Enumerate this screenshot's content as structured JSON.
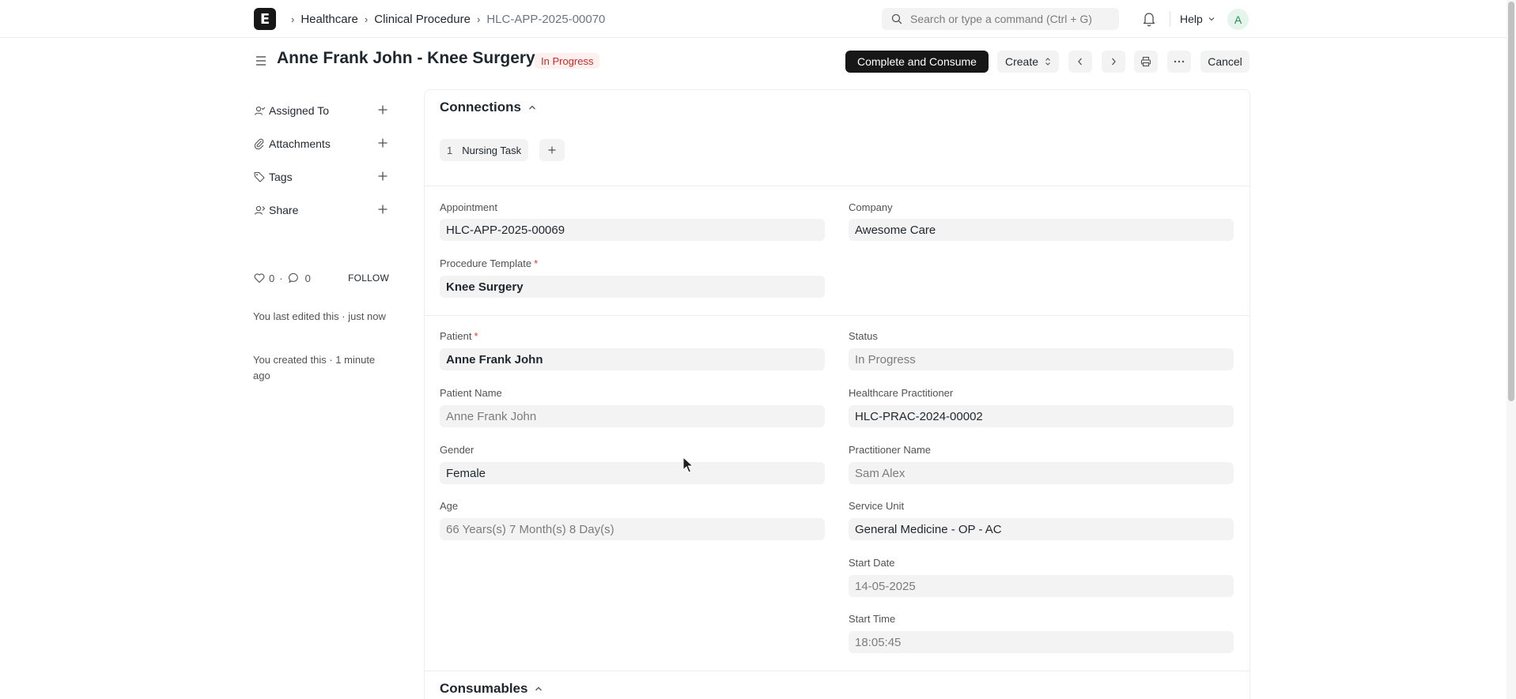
{
  "navbar": {
    "logo_letter": "E",
    "breadcrumbs": [
      {
        "label": "Healthcare"
      },
      {
        "label": "Clinical Procedure"
      },
      {
        "label": "HLC-APP-2025-00070"
      }
    ],
    "search_placeholder": "Search or type a command (Ctrl + G)",
    "help_label": "Help",
    "avatar_initial": "A"
  },
  "page": {
    "title": "Anne Frank John - Knee Surgery",
    "status": "In Progress",
    "buttons": {
      "complete": "Complete and Consume",
      "create": "Create",
      "cancel": "Cancel"
    }
  },
  "sidebar": {
    "items": [
      {
        "label": "Assigned To",
        "icon": "assign-icon"
      },
      {
        "label": "Attachments",
        "icon": "paperclip-icon"
      },
      {
        "label": "Tags",
        "icon": "tag-icon"
      },
      {
        "label": "Share",
        "icon": "share-icon"
      }
    ],
    "likes": "0",
    "comments": "0",
    "follow_label": "FOLLOW",
    "activity": [
      "You last edited this · just now",
      "You created this · 1 minute ago"
    ]
  },
  "connections": {
    "title": "Connections",
    "chip_count": "1",
    "chip_label": "Nursing Task"
  },
  "fields": {
    "appointment": {
      "label": "Appointment",
      "value": "HLC-APP-2025-00069"
    },
    "company": {
      "label": "Company",
      "value": "Awesome Care"
    },
    "procedure_template": {
      "label": "Procedure Template",
      "value": "Knee Surgery"
    },
    "patient": {
      "label": "Patient",
      "value": "Anne Frank John"
    },
    "status": {
      "label": "Status",
      "value": "In Progress"
    },
    "patient_name": {
      "label": "Patient Name",
      "value": "Anne Frank John"
    },
    "practitioner": {
      "label": "Healthcare Practitioner",
      "value": "HLC-PRAC-2024-00002"
    },
    "gender": {
      "label": "Gender",
      "value": "Female"
    },
    "practitioner_name": {
      "label": "Practitioner Name",
      "value": "Sam Alex"
    },
    "age": {
      "label": "Age",
      "value": "66 Years(s) 7 Month(s) 8 Day(s)"
    },
    "service_unit": {
      "label": "Service Unit",
      "value": "General Medicine - OP - AC"
    },
    "start_date": {
      "label": "Start Date",
      "value": "14-05-2025"
    },
    "start_time": {
      "label": "Start Time",
      "value": "18:05:45"
    }
  },
  "consumables": {
    "title": "Consumables"
  }
}
